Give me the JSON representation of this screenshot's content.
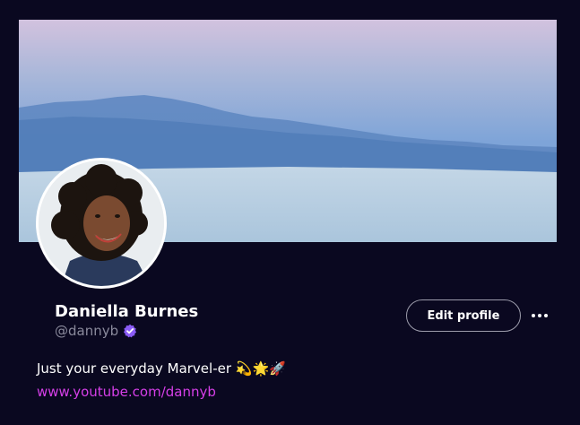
{
  "profile": {
    "display_name": "Daniella Burnes",
    "handle": "@dannyb",
    "verified": true,
    "bio": "Just your everyday Marvel-er 💫🌟🚀",
    "link": "www.youtube.com/dannyb"
  },
  "actions": {
    "edit_profile_label": "Edit profile"
  },
  "icons": {
    "verified": "verified-badge-icon",
    "more": "more-horizontal-icon"
  },
  "colors": {
    "background": "#0a0820",
    "link": "#d63fe8",
    "verified_badge": "#8b5cf6",
    "handle": "#8a8a9c"
  }
}
